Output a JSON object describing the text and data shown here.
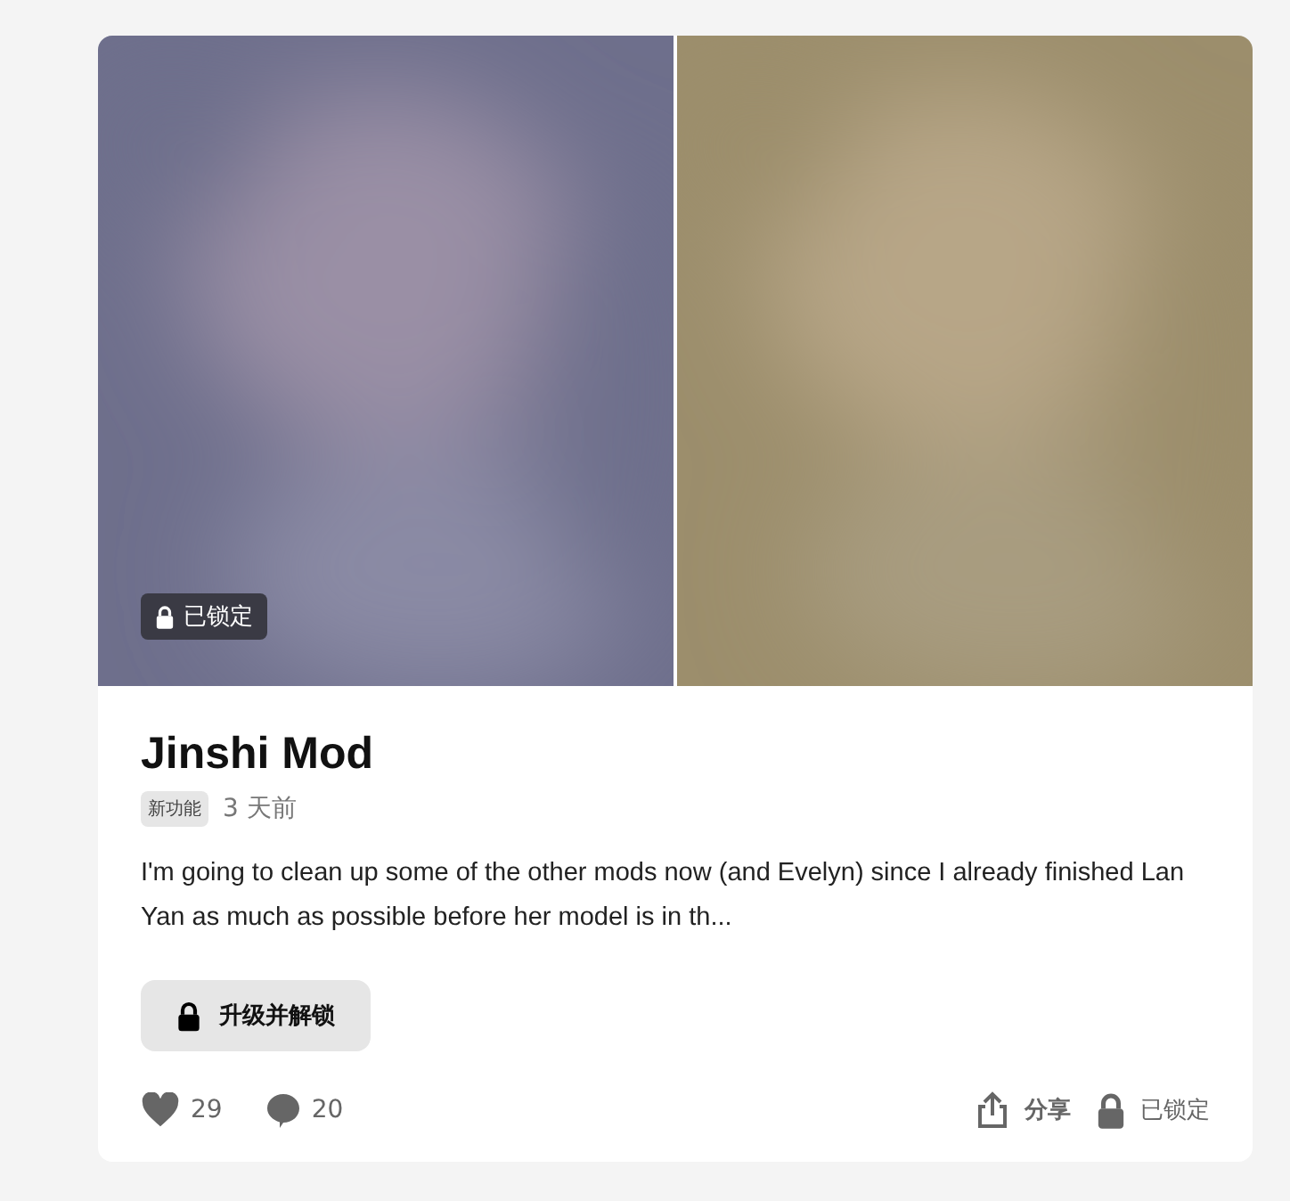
{
  "lock_badge": "已锁定",
  "title": "Jinshi Mod",
  "tag": "新功能",
  "time": "3 天前",
  "excerpt": "I'm going to clean up some of the other mods now (and Evelyn) since I already finished Lan Yan as much as possible before her model is in th...",
  "unlock_button": "升级并解锁",
  "likes": "29",
  "comments": "20",
  "share": "分享",
  "status": "已锁定"
}
